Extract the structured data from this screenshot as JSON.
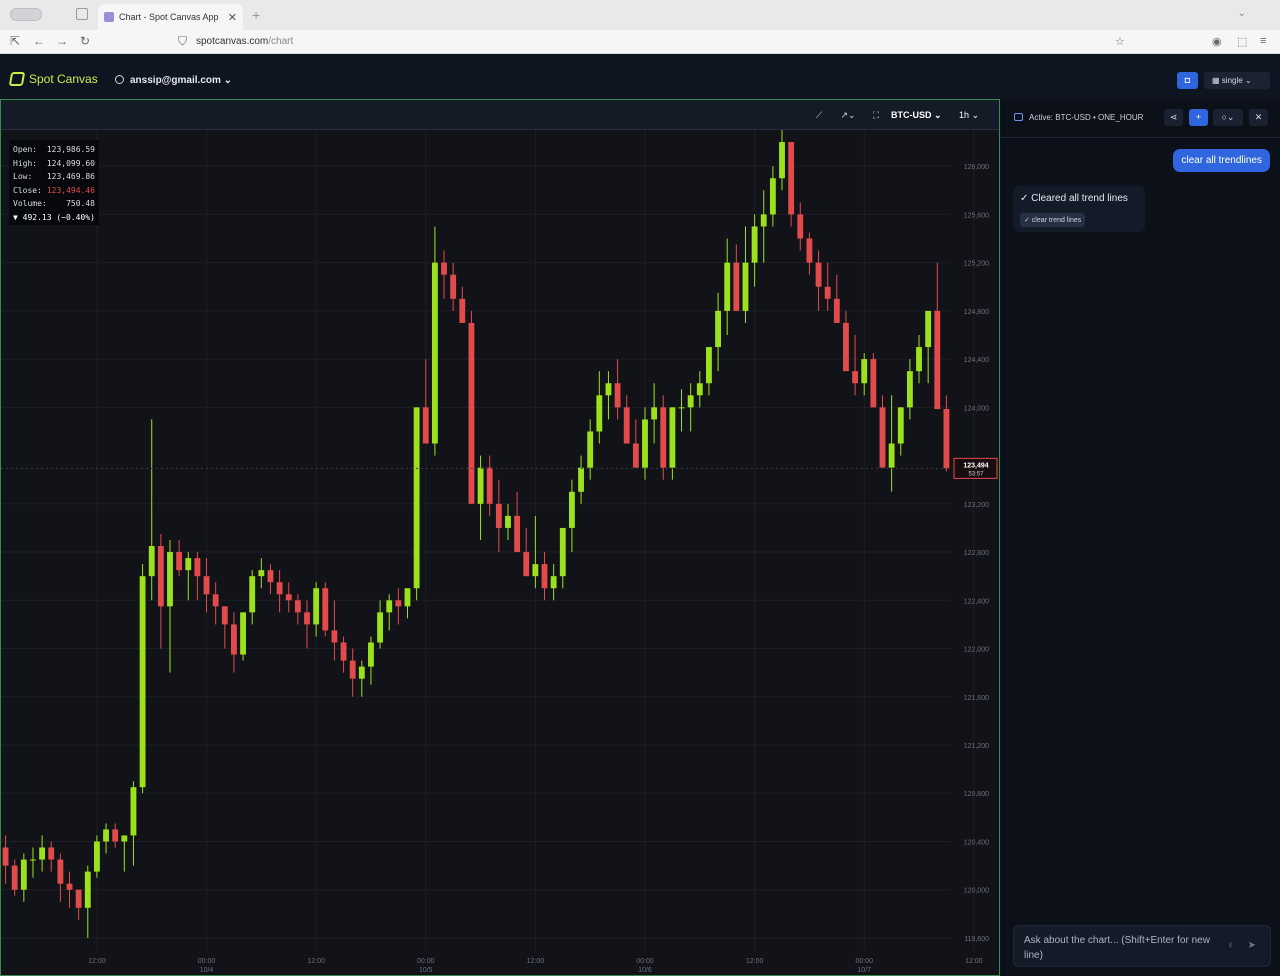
{
  "browser": {
    "tab_title": "Chart - Spot Canvas App",
    "tab_close": "✕",
    "new_tab": "+",
    "url_host": "spotcanvas.com",
    "url_path": "/chart"
  },
  "header": {
    "logo_text": "Spot Canvas",
    "user_email": "anssip@gmail.com",
    "layout_label": "single"
  },
  "chart_toolbar": {
    "symbol": "BTC-USD",
    "timeframe": "1h"
  },
  "ohlc": {
    "open_label": "Open:",
    "open_value": "123,986.59",
    "high_label": "High:",
    "high_value": "124,099.60",
    "low_label": "Low:",
    "low_value": "123,469.86",
    "close_label": "Close:",
    "close_value": "123,494.46",
    "volume_label": "Volume:",
    "volume_value": "750.48",
    "change_text": "▼  492.13 (−0.40%)"
  },
  "price_tag": {
    "price": "123,494",
    "countdown": "53:57"
  },
  "chart_data": {
    "type": "candlestick",
    "yticks": [
      126000,
      125600,
      125200,
      124800,
      124400,
      124000,
      123200,
      122800,
      122400,
      122000,
      121600,
      121200,
      120800,
      120400,
      120000,
      119600
    ],
    "ytick_labels": [
      "126,000",
      "125,600",
      "125,200",
      "124,800",
      "124,400",
      "124,000",
      "123,200",
      "122,800",
      "122,400",
      "122,000",
      "121,600",
      "121,200",
      "120,800",
      "120,400",
      "120,000",
      "119,600"
    ],
    "ylim": [
      119500,
      126300
    ],
    "xticks": [
      {
        "label": "12:00",
        "sub": "",
        "index": 10
      },
      {
        "label": "00:00",
        "sub": "10/4",
        "index": 22
      },
      {
        "label": "12:00",
        "sub": "",
        "index": 34
      },
      {
        "label": "00:00",
        "sub": "10/5",
        "index": 46
      },
      {
        "label": "12:00",
        "sub": "",
        "index": 58
      },
      {
        "label": "00:00",
        "sub": "10/6",
        "index": 70
      },
      {
        "label": "12:00",
        "sub": "",
        "index": 82
      },
      {
        "label": "00:00",
        "sub": "10/7",
        "index": 94
      },
      {
        "label": "12:00",
        "sub": "",
        "index": 106
      }
    ],
    "up_color": "#9be21d",
    "down_color": "#e14b4b",
    "candles": [
      [
        120350,
        120450,
        120050,
        120200
      ],
      [
        120200,
        120250,
        119950,
        120000
      ],
      [
        120000,
        120300,
        119900,
        120250
      ],
      [
        120250,
        120350,
        120100,
        120250
      ],
      [
        120250,
        120450,
        120150,
        120350
      ],
      [
        120350,
        120400,
        120150,
        120250
      ],
      [
        120250,
        120300,
        119900,
        120050
      ],
      [
        120050,
        120150,
        119850,
        120000
      ],
      [
        120000,
        119950,
        119750,
        119850
      ],
      [
        119850,
        120200,
        119600,
        120150
      ],
      [
        120150,
        120450,
        120100,
        120400
      ],
      [
        120400,
        120550,
        120300,
        120500
      ],
      [
        120500,
        120550,
        120350,
        120400
      ],
      [
        120400,
        120450,
        120150,
        120450
      ],
      [
        120450,
        120900,
        120200,
        120850
      ],
      [
        120850,
        122700,
        120800,
        122600
      ],
      [
        122600,
        123900,
        122400,
        122850
      ],
      [
        122850,
        122950,
        122000,
        122350
      ],
      [
        122350,
        122900,
        121800,
        122800
      ],
      [
        122800,
        122900,
        122600,
        122650
      ],
      [
        122650,
        122800,
        122400,
        122750
      ],
      [
        122750,
        122800,
        122400,
        122600
      ],
      [
        122600,
        122750,
        122300,
        122450
      ],
      [
        122450,
        122550,
        122200,
        122350
      ],
      [
        122350,
        122350,
        122000,
        122200
      ],
      [
        122200,
        122300,
        121800,
        121950
      ],
      [
        121950,
        122300,
        121900,
        122300
      ],
      [
        122300,
        122650,
        122200,
        122600
      ],
      [
        122600,
        122750,
        122500,
        122650
      ],
      [
        122650,
        122700,
        122450,
        122550
      ],
      [
        122550,
        122650,
        122300,
        122450
      ],
      [
        122450,
        122550,
        122300,
        122400
      ],
      [
        122400,
        122450,
        122200,
        122300
      ],
      [
        122300,
        122400,
        122000,
        122200
      ],
      [
        122200,
        122550,
        122100,
        122500
      ],
      [
        122500,
        122550,
        122100,
        122150
      ],
      [
        122150,
        122400,
        121900,
        122050
      ],
      [
        122050,
        122100,
        121800,
        121900
      ],
      [
        121900,
        122000,
        121600,
        121750
      ],
      [
        121750,
        121900,
        121600,
        121850
      ],
      [
        121850,
        122100,
        121700,
        122050
      ],
      [
        122050,
        122400,
        122000,
        122300
      ],
      [
        122300,
        122450,
        122150,
        122400
      ],
      [
        122400,
        122500,
        122200,
        122350
      ],
      [
        122350,
        122500,
        122250,
        122500
      ],
      [
        122500,
        124000,
        122400,
        124000
      ],
      [
        124000,
        124400,
        123700,
        123700
      ],
      [
        123700,
        125500,
        123600,
        125200
      ],
      [
        125200,
        125300,
        124900,
        125100
      ],
      [
        125100,
        125200,
        124800,
        124900
      ],
      [
        124900,
        125000,
        124700,
        124700
      ],
      [
        124700,
        124800,
        123200,
        123200
      ],
      [
        123200,
        123600,
        122900,
        123500
      ],
      [
        123500,
        123600,
        123100,
        123200
      ],
      [
        123200,
        123400,
        122800,
        123000
      ],
      [
        123000,
        123200,
        122900,
        123100
      ],
      [
        123100,
        123300,
        122800,
        122800
      ],
      [
        122800,
        123000,
        122600,
        122600
      ],
      [
        122600,
        123100,
        122500,
        122700
      ],
      [
        122700,
        122800,
        122400,
        122500
      ],
      [
        122500,
        122700,
        122400,
        122600
      ],
      [
        122600,
        123000,
        122500,
        123000
      ],
      [
        123000,
        123400,
        122800,
        123300
      ],
      [
        123300,
        123600,
        123200,
        123500
      ],
      [
        123500,
        123900,
        123400,
        123800
      ],
      [
        123800,
        124300,
        123700,
        124100
      ],
      [
        124100,
        124300,
        123900,
        124200
      ],
      [
        124200,
        124400,
        123900,
        124000
      ],
      [
        124000,
        124100,
        123700,
        123700
      ],
      [
        123700,
        123900,
        123500,
        123500
      ],
      [
        123500,
        124000,
        123400,
        123900
      ],
      [
        123900,
        124200,
        123700,
        124000
      ],
      [
        124000,
        124100,
        123400,
        123500
      ],
      [
        123500,
        124000,
        123400,
        124000
      ],
      [
        124000,
        124150,
        123800,
        124000
      ],
      [
        124000,
        124200,
        123800,
        124100
      ],
      [
        124100,
        124300,
        124000,
        124200
      ],
      [
        124200,
        124500,
        124100,
        124500
      ],
      [
        124500,
        124950,
        124300,
        124800
      ],
      [
        124800,
        125400,
        124600,
        125200
      ],
      [
        125200,
        125350,
        124800,
        124800
      ],
      [
        124800,
        125500,
        124700,
        125200
      ],
      [
        125200,
        125600,
        125000,
        125500
      ],
      [
        125500,
        125800,
        125200,
        125600
      ],
      [
        125600,
        126000,
        125500,
        125900
      ],
      [
        125900,
        126300,
        125800,
        126200
      ],
      [
        126200,
        126200,
        125500,
        125600
      ],
      [
        125600,
        125700,
        125300,
        125400
      ],
      [
        125400,
        125450,
        125100,
        125200
      ],
      [
        125200,
        125300,
        124800,
        125000
      ],
      [
        125000,
        125200,
        124800,
        124900
      ],
      [
        124900,
        125100,
        124700,
        124700
      ],
      [
        124700,
        124800,
        124400,
        124300
      ],
      [
        124300,
        124600,
        124100,
        124200
      ],
      [
        124200,
        124450,
        124100,
        124400
      ],
      [
        124400,
        124450,
        124000,
        124000
      ],
      [
        124000,
        124100,
        123600,
        123500
      ],
      [
        123500,
        124100,
        123300,
        123700
      ],
      [
        123700,
        124000,
        123600,
        124000
      ],
      [
        124000,
        124400,
        123900,
        124300
      ],
      [
        124300,
        124600,
        124200,
        124500
      ],
      [
        124500,
        124800,
        124200,
        124800
      ],
      [
        124800,
        125200,
        124100,
        123986
      ],
      [
        123986,
        124099,
        123469,
        123494
      ]
    ]
  },
  "side": {
    "active_label": "Active: BTC-USD • ONE_HOUR",
    "user_msg": "clear all trendlines",
    "bot_msg": "✓ Cleared all trend lines",
    "bot_chip": "✓ clear trend lines",
    "input_placeholder": "Ask about the chart... (Shift+Enter for new line)"
  }
}
